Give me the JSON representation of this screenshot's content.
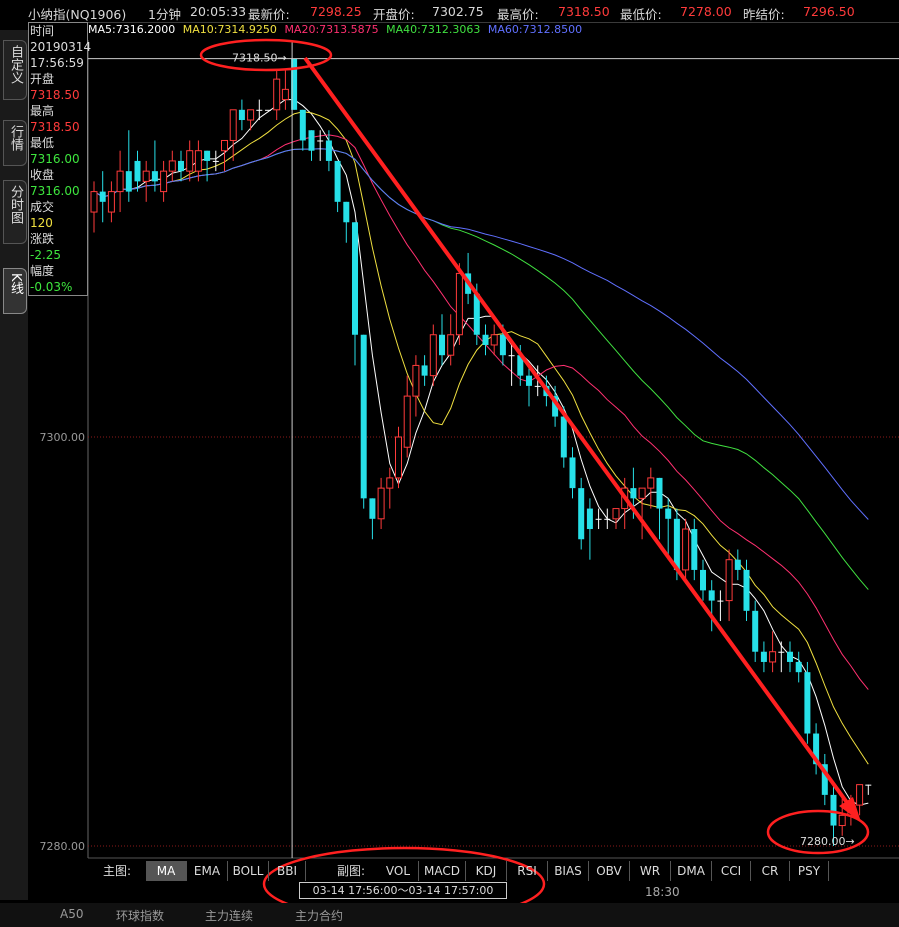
{
  "header": {
    "instrument": "小纳指(NQ1906)",
    "period": "1分钟",
    "time": "20:05:33",
    "latest_label": "最新价:",
    "latest_value": "7298.25",
    "open_label": "开盘价:",
    "open_value": "7302.75",
    "high_label": "最高价:",
    "high_value": "7318.50",
    "low_label": "最低价:",
    "low_value": "7278.00",
    "prev_label": "昨结价:",
    "prev_value": "7296.50"
  },
  "ma_legend": [
    {
      "text": "MA5:7316.2000",
      "color": "#ffffff"
    },
    {
      "text": "MA10:7314.9250",
      "color": "#f0e040"
    },
    {
      "text": "MA20:7313.5875",
      "color": "#ff3070"
    },
    {
      "text": "MA40:7312.3063",
      "color": "#40e040"
    },
    {
      "text": "MA60:7312.8500",
      "color": "#6070ff"
    }
  ],
  "left_tabs": [
    "自定义",
    "行情",
    "分时图",
    "K线"
  ],
  "info_panel": {
    "time_label": "时间",
    "date": "20190314",
    "clock": "17:56:59",
    "open_label": "开盘",
    "open": "7318.50",
    "high_label": "最高",
    "high": "7318.50",
    "low_label": "最低",
    "low": "7316.00",
    "close_label": "收盘",
    "close": "7316.00",
    "volume_label": "成交",
    "volume": "120",
    "change_label": "涨跌",
    "change": "-2.25",
    "pct_label": "幅度",
    "pct": "-0.03%"
  },
  "chart_data": {
    "type": "candlestick",
    "interval": "1 minute",
    "y_ticks": [
      "7300.00",
      "7280.00"
    ],
    "ylim": [
      7278.0,
      7318.5
    ],
    "annotations": {
      "high_marker": "7318.50",
      "low_marker": "7280.00"
    },
    "x_tick": "18:30",
    "candles": [
      {
        "o": 7311.0,
        "h": 7312.5,
        "l": 7310.0,
        "c": 7312.0
      },
      {
        "o": 7312.0,
        "h": 7313.0,
        "l": 7310.5,
        "c": 7311.5
      },
      {
        "o": 7311.0,
        "h": 7312.5,
        "l": 7310.5,
        "c": 7312.0
      },
      {
        "o": 7312.0,
        "h": 7314.0,
        "l": 7311.0,
        "c": 7313.0
      },
      {
        "o": 7313.0,
        "h": 7315.0,
        "l": 7311.5,
        "c": 7312.0
      },
      {
        "o": 7313.5,
        "h": 7314.0,
        "l": 7312.0,
        "c": 7312.5
      },
      {
        "o": 7312.5,
        "h": 7313.5,
        "l": 7311.5,
        "c": 7313.0
      },
      {
        "o": 7313.0,
        "h": 7314.5,
        "l": 7312.0,
        "c": 7312.5
      },
      {
        "o": 7312.0,
        "h": 7313.5,
        "l": 7311.5,
        "c": 7313.0
      },
      {
        "o": 7313.0,
        "h": 7314.0,
        "l": 7312.5,
        "c": 7313.5
      },
      {
        "o": 7313.5,
        "h": 7314.0,
        "l": 7312.5,
        "c": 7313.0
      },
      {
        "o": 7313.0,
        "h": 7314.5,
        "l": 7312.5,
        "c": 7314.0
      },
      {
        "o": 7313.0,
        "h": 7314.5,
        "l": 7312.5,
        "c": 7314.0
      },
      {
        "o": 7314.0,
        "h": 7314.0,
        "l": 7312.5,
        "c": 7313.5
      },
      {
        "o": 7313.5,
        "h": 7314.0,
        "l": 7313.0,
        "c": 7313.5
      },
      {
        "o": 7314.0,
        "h": 7314.5,
        "l": 7313.0,
        "c": 7314.5
      },
      {
        "o": 7314.5,
        "h": 7316.0,
        "l": 7313.5,
        "c": 7316.0
      },
      {
        "o": 7316.0,
        "h": 7316.5,
        "l": 7315.0,
        "c": 7315.5
      },
      {
        "o": 7315.5,
        "h": 7316.0,
        "l": 7315.0,
        "c": 7316.0
      },
      {
        "o": 7316.0,
        "h": 7316.5,
        "l": 7315.5,
        "c": 7316.0
      },
      {
        "o": 7316.0,
        "h": 7316.0,
        "l": 7316.0,
        "c": 7316.0
      },
      {
        "o": 7316.0,
        "h": 7318.0,
        "l": 7315.5,
        "c": 7317.5
      },
      {
        "o": 7316.5,
        "h": 7318.0,
        "l": 7316.0,
        "c": 7317.0
      },
      {
        "o": 7318.5,
        "h": 7318.5,
        "l": 7316.0,
        "c": 7316.0
      },
      {
        "o": 7316.0,
        "h": 7316.0,
        "l": 7314.0,
        "c": 7314.5
      },
      {
        "o": 7315.0,
        "h": 7315.0,
        "l": 7313.5,
        "c": 7314.0
      },
      {
        "o": 7314.5,
        "h": 7315.0,
        "l": 7313.5,
        "c": 7314.5
      },
      {
        "o": 7314.5,
        "h": 7315.0,
        "l": 7313.0,
        "c": 7313.5
      },
      {
        "o": 7313.5,
        "h": 7313.5,
        "l": 7311.0,
        "c": 7311.5
      },
      {
        "o": 7311.5,
        "h": 7311.5,
        "l": 7309.5,
        "c": 7310.5
      },
      {
        "o": 7310.5,
        "h": 7310.5,
        "l": 7303.5,
        "c": 7305.0
      },
      {
        "o": 7305.0,
        "h": 7305.0,
        "l": 7296.5,
        "c": 7297.0
      },
      {
        "o": 7297.0,
        "h": 7297.0,
        "l": 7295.0,
        "c": 7296.0
      },
      {
        "o": 7296.0,
        "h": 7298.0,
        "l": 7295.5,
        "c": 7297.5
      },
      {
        "o": 7297.5,
        "h": 7298.5,
        "l": 7296.5,
        "c": 7298.0
      },
      {
        "o": 7298.0,
        "h": 7300.5,
        "l": 7297.5,
        "c": 7300.0
      },
      {
        "o": 7299.5,
        "h": 7303.0,
        "l": 7299.0,
        "c": 7302.0
      },
      {
        "o": 7302.0,
        "h": 7304.0,
        "l": 7301.0,
        "c": 7303.5
      },
      {
        "o": 7303.5,
        "h": 7304.0,
        "l": 7302.5,
        "c": 7303.0
      },
      {
        "o": 7303.0,
        "h": 7305.5,
        "l": 7302.5,
        "c": 7305.0
      },
      {
        "o": 7305.0,
        "h": 7306.0,
        "l": 7303.5,
        "c": 7304.0
      },
      {
        "o": 7304.0,
        "h": 7306.0,
        "l": 7303.5,
        "c": 7305.0
      },
      {
        "o": 7305.0,
        "h": 7308.5,
        "l": 7304.5,
        "c": 7308.0
      },
      {
        "o": 7308.0,
        "h": 7309.0,
        "l": 7306.5,
        "c": 7307.0
      },
      {
        "o": 7307.0,
        "h": 7307.5,
        "l": 7304.5,
        "c": 7305.0
      },
      {
        "o": 7305.0,
        "h": 7305.5,
        "l": 7304.0,
        "c": 7304.5
      },
      {
        "o": 7304.5,
        "h": 7305.5,
        "l": 7304.0,
        "c": 7305.0
      },
      {
        "o": 7305.0,
        "h": 7305.5,
        "l": 7303.5,
        "c": 7304.0
      },
      {
        "o": 7304.0,
        "h": 7304.5,
        "l": 7302.5,
        "c": 7304.0
      },
      {
        "o": 7304.0,
        "h": 7304.5,
        "l": 7302.5,
        "c": 7303.0
      },
      {
        "o": 7303.0,
        "h": 7303.5,
        "l": 7301.5,
        "c": 7302.5
      },
      {
        "o": 7302.5,
        "h": 7303.5,
        "l": 7302.0,
        "c": 7302.5
      },
      {
        "o": 7302.5,
        "h": 7303.0,
        "l": 7301.5,
        "c": 7302.0
      },
      {
        "o": 7302.0,
        "h": 7302.5,
        "l": 7300.5,
        "c": 7301.0
      },
      {
        "o": 7301.0,
        "h": 7301.5,
        "l": 7298.5,
        "c": 7299.0
      },
      {
        "o": 7299.0,
        "h": 7299.5,
        "l": 7297.0,
        "c": 7297.5
      },
      {
        "o": 7297.5,
        "h": 7298.0,
        "l": 7294.5,
        "c": 7295.0
      },
      {
        "o": 7296.5,
        "h": 7297.0,
        "l": 7294.0,
        "c": 7295.5
      },
      {
        "o": 7296.0,
        "h": 7296.5,
        "l": 7295.5,
        "c": 7296.0
      },
      {
        "o": 7296.0,
        "h": 7296.5,
        "l": 7295.5,
        "c": 7296.0
      },
      {
        "o": 7296.0,
        "h": 7296.5,
        "l": 7295.5,
        "c": 7296.5
      },
      {
        "o": 7296.5,
        "h": 7298.0,
        "l": 7295.5,
        "c": 7297.5
      },
      {
        "o": 7297.5,
        "h": 7298.5,
        "l": 7296.0,
        "c": 7297.0
      },
      {
        "o": 7297.0,
        "h": 7297.5,
        "l": 7295.0,
        "c": 7297.5
      },
      {
        "o": 7297.5,
        "h": 7298.5,
        "l": 7296.5,
        "c": 7298.0
      },
      {
        "o": 7298.0,
        "h": 7298.0,
        "l": 7295.0,
        "c": 7296.5
      },
      {
        "o": 7296.5,
        "h": 7297.0,
        "l": 7294.0,
        "c": 7296.0
      },
      {
        "o": 7296.0,
        "h": 7296.5,
        "l": 7293.0,
        "c": 7293.5
      },
      {
        "o": 7293.5,
        "h": 7296.0,
        "l": 7293.0,
        "c": 7295.5
      },
      {
        "o": 7295.5,
        "h": 7296.0,
        "l": 7293.0,
        "c": 7293.5
      },
      {
        "o": 7293.5,
        "h": 7294.0,
        "l": 7292.0,
        "c": 7292.5
      },
      {
        "o": 7292.5,
        "h": 7293.0,
        "l": 7290.5,
        "c": 7292.0
      },
      {
        "o": 7292.0,
        "h": 7292.5,
        "l": 7291.0,
        "c": 7292.0
      },
      {
        "o": 7292.0,
        "h": 7294.5,
        "l": 7291.0,
        "c": 7294.0
      },
      {
        "o": 7294.0,
        "h": 7294.5,
        "l": 7293.0,
        "c": 7293.5
      },
      {
        "o": 7293.5,
        "h": 7294.0,
        "l": 7291.0,
        "c": 7291.5
      },
      {
        "o": 7291.5,
        "h": 7292.0,
        "l": 7289.0,
        "c": 7289.5
      },
      {
        "o": 7289.5,
        "h": 7290.0,
        "l": 7288.5,
        "c": 7289.0
      },
      {
        "o": 7289.0,
        "h": 7290.5,
        "l": 7288.5,
        "c": 7289.5
      },
      {
        "o": 7289.5,
        "h": 7290.0,
        "l": 7288.5,
        "c": 7289.5
      },
      {
        "o": 7289.5,
        "h": 7290.0,
        "l": 7288.5,
        "c": 7289.0
      },
      {
        "o": 7289.0,
        "h": 7289.5,
        "l": 7288.0,
        "c": 7288.5
      },
      {
        "o": 7288.5,
        "h": 7289.0,
        "l": 7285.0,
        "c": 7285.5
      },
      {
        "o": 7285.5,
        "h": 7286.0,
        "l": 7283.5,
        "c": 7284.0
      },
      {
        "o": 7284.0,
        "h": 7284.5,
        "l": 7282.0,
        "c": 7282.5
      },
      {
        "o": 7282.5,
        "h": 7283.0,
        "l": 7280.0,
        "c": 7281.0
      },
      {
        "o": 7281.0,
        "h": 7282.5,
        "l": 7280.5,
        "c": 7281.5
      },
      {
        "o": 7281.5,
        "h": 7282.5,
        "l": 7281.0,
        "c": 7282.0
      },
      {
        "o": 7282.0,
        "h": 7283.0,
        "l": 7281.5,
        "c": 7283.0
      },
      {
        "o": 7283.0,
        "h": 7283.0,
        "l": 7282.5,
        "c": 7283.0
      }
    ]
  },
  "indicator_bar": {
    "main_label": "主图:",
    "main": [
      "MA",
      "EMA",
      "BOLL",
      "BBI"
    ],
    "sub_label": "副图:",
    "sub": [
      "VOL",
      "MACD",
      "KDJ",
      "RSI",
      "BIAS",
      "OBV",
      "WR",
      "DMA",
      "CCI",
      "CR",
      "PSY"
    ],
    "active": "MA"
  },
  "time_range": "03-14  17:56:00～03-14  17:57:00",
  "axis_time": "18:30",
  "bottom_tabs": [
    "A50",
    "环球指数",
    "主力连续",
    "主力合约"
  ],
  "colors": {
    "up": "#ff3b3b",
    "down": "#27e0e8",
    "arrow": "#ff2020",
    "highlight_circle": "#ff2020"
  }
}
